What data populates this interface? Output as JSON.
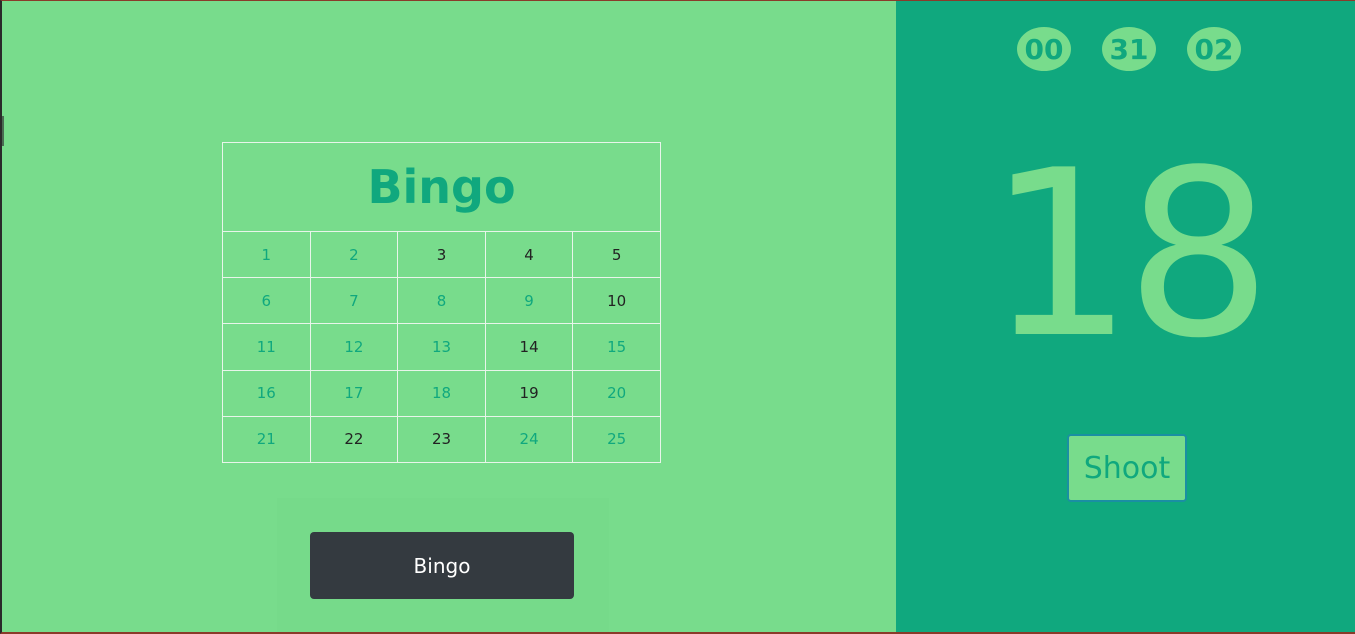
{
  "board": {
    "title": "Bingo",
    "rows": [
      [
        {
          "n": "1",
          "marked": true
        },
        {
          "n": "2",
          "marked": true
        },
        {
          "n": "3",
          "marked": false
        },
        {
          "n": "4",
          "marked": false
        },
        {
          "n": "5",
          "marked": false
        }
      ],
      [
        {
          "n": "6",
          "marked": true
        },
        {
          "n": "7",
          "marked": true
        },
        {
          "n": "8",
          "marked": true
        },
        {
          "n": "9",
          "marked": true
        },
        {
          "n": "10",
          "marked": false
        }
      ],
      [
        {
          "n": "11",
          "marked": true
        },
        {
          "n": "12",
          "marked": true
        },
        {
          "n": "13",
          "marked": true
        },
        {
          "n": "14",
          "marked": false
        },
        {
          "n": "15",
          "marked": true
        }
      ],
      [
        {
          "n": "16",
          "marked": true
        },
        {
          "n": "17",
          "marked": true
        },
        {
          "n": "18",
          "marked": true
        },
        {
          "n": "19",
          "marked": false
        },
        {
          "n": "20",
          "marked": true
        }
      ],
      [
        {
          "n": "21",
          "marked": true
        },
        {
          "n": "22",
          "marked": false
        },
        {
          "n": "23",
          "marked": false
        },
        {
          "n": "24",
          "marked": true
        },
        {
          "n": "25",
          "marked": true
        }
      ]
    ]
  },
  "actions": {
    "bingo_label": "Bingo",
    "shoot_label": "Shoot"
  },
  "timer": {
    "hours": "00",
    "minutes": "31",
    "seconds": "02"
  },
  "current_number": "18",
  "colors": {
    "left_bg": "#78dc8c",
    "right_bg": "#10a87e",
    "marked_text": "#10a87e",
    "button_dark": "#343a40"
  }
}
